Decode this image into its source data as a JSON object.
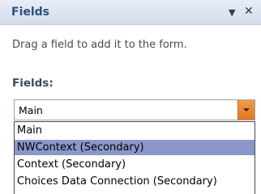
{
  "pane": {
    "title": "Fields",
    "menu_icon": "dropdown-arrow-icon",
    "close_icon": "close-icon",
    "instruction": "Drag a field to add it to the form.",
    "section_label": "Fields:"
  },
  "data_source": {
    "selected_value": "Main",
    "options": [
      {
        "label": "Main",
        "highlighted": false
      },
      {
        "label": "NWContext (Secondary)",
        "highlighted": true
      },
      {
        "label": "Context (Secondary)",
        "highlighted": false
      },
      {
        "label": "Choices Data Connection (Secondary)",
        "highlighted": false
      }
    ]
  },
  "colors": {
    "title_text": "#2d4f7a",
    "title_bar": "#dde5f1",
    "dropdown_button": "#ec8a35",
    "highlight": "#8b97c9"
  }
}
